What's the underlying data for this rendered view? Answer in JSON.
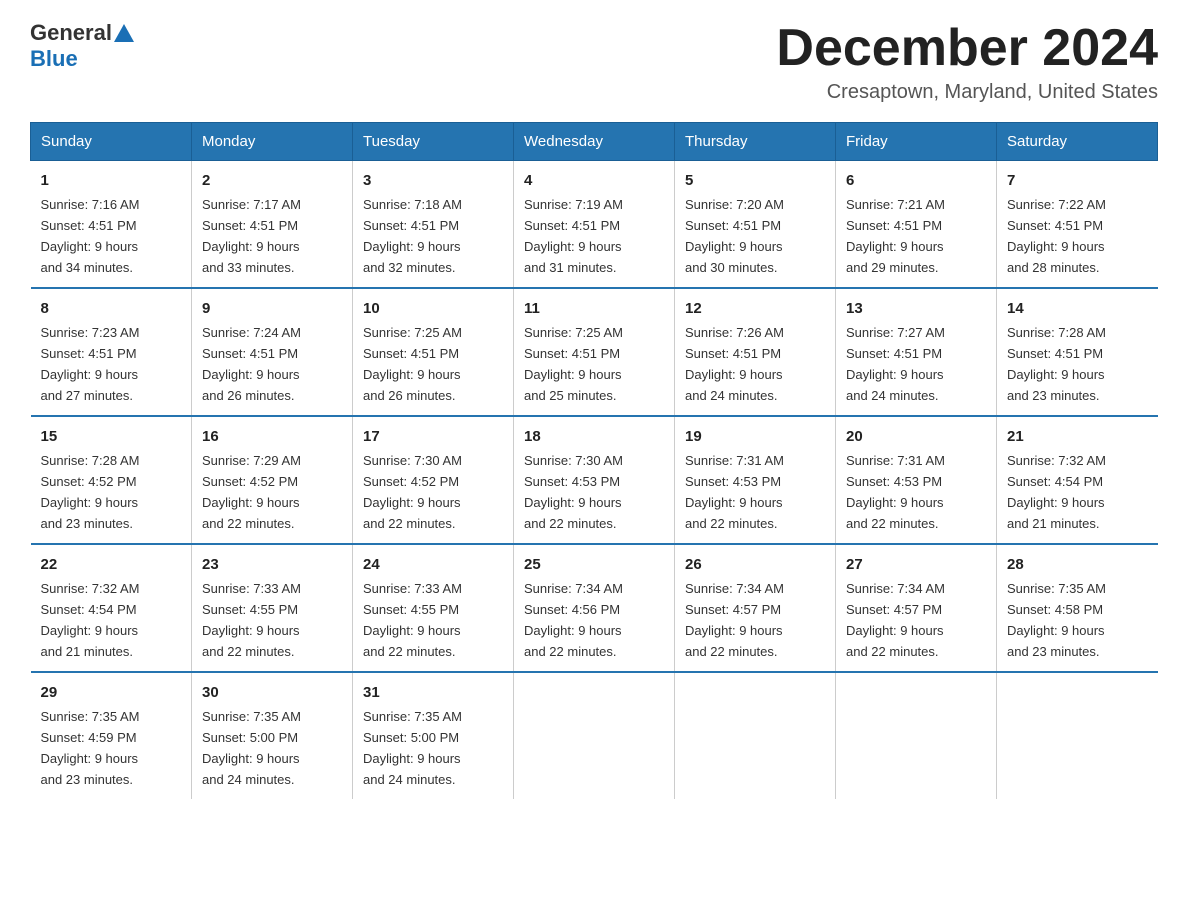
{
  "logo": {
    "general": "General",
    "blue": "Blue"
  },
  "title": "December 2024",
  "subtitle": "Cresaptown, Maryland, United States",
  "days_of_week": [
    "Sunday",
    "Monday",
    "Tuesday",
    "Wednesday",
    "Thursday",
    "Friday",
    "Saturday"
  ],
  "weeks": [
    [
      {
        "num": "1",
        "sunrise": "7:16 AM",
        "sunset": "4:51 PM",
        "daylight": "9 hours and 34 minutes."
      },
      {
        "num": "2",
        "sunrise": "7:17 AM",
        "sunset": "4:51 PM",
        "daylight": "9 hours and 33 minutes."
      },
      {
        "num": "3",
        "sunrise": "7:18 AM",
        "sunset": "4:51 PM",
        "daylight": "9 hours and 32 minutes."
      },
      {
        "num": "4",
        "sunrise": "7:19 AM",
        "sunset": "4:51 PM",
        "daylight": "9 hours and 31 minutes."
      },
      {
        "num": "5",
        "sunrise": "7:20 AM",
        "sunset": "4:51 PM",
        "daylight": "9 hours and 30 minutes."
      },
      {
        "num": "6",
        "sunrise": "7:21 AM",
        "sunset": "4:51 PM",
        "daylight": "9 hours and 29 minutes."
      },
      {
        "num": "7",
        "sunrise": "7:22 AM",
        "sunset": "4:51 PM",
        "daylight": "9 hours and 28 minutes."
      }
    ],
    [
      {
        "num": "8",
        "sunrise": "7:23 AM",
        "sunset": "4:51 PM",
        "daylight": "9 hours and 27 minutes."
      },
      {
        "num": "9",
        "sunrise": "7:24 AM",
        "sunset": "4:51 PM",
        "daylight": "9 hours and 26 minutes."
      },
      {
        "num": "10",
        "sunrise": "7:25 AM",
        "sunset": "4:51 PM",
        "daylight": "9 hours and 26 minutes."
      },
      {
        "num": "11",
        "sunrise": "7:25 AM",
        "sunset": "4:51 PM",
        "daylight": "9 hours and 25 minutes."
      },
      {
        "num": "12",
        "sunrise": "7:26 AM",
        "sunset": "4:51 PM",
        "daylight": "9 hours and 24 minutes."
      },
      {
        "num": "13",
        "sunrise": "7:27 AM",
        "sunset": "4:51 PM",
        "daylight": "9 hours and 24 minutes."
      },
      {
        "num": "14",
        "sunrise": "7:28 AM",
        "sunset": "4:51 PM",
        "daylight": "9 hours and 23 minutes."
      }
    ],
    [
      {
        "num": "15",
        "sunrise": "7:28 AM",
        "sunset": "4:52 PM",
        "daylight": "9 hours and 23 minutes."
      },
      {
        "num": "16",
        "sunrise": "7:29 AM",
        "sunset": "4:52 PM",
        "daylight": "9 hours and 22 minutes."
      },
      {
        "num": "17",
        "sunrise": "7:30 AM",
        "sunset": "4:52 PM",
        "daylight": "9 hours and 22 minutes."
      },
      {
        "num": "18",
        "sunrise": "7:30 AM",
        "sunset": "4:53 PM",
        "daylight": "9 hours and 22 minutes."
      },
      {
        "num": "19",
        "sunrise": "7:31 AM",
        "sunset": "4:53 PM",
        "daylight": "9 hours and 22 minutes."
      },
      {
        "num": "20",
        "sunrise": "7:31 AM",
        "sunset": "4:53 PM",
        "daylight": "9 hours and 22 minutes."
      },
      {
        "num": "21",
        "sunrise": "7:32 AM",
        "sunset": "4:54 PM",
        "daylight": "9 hours and 21 minutes."
      }
    ],
    [
      {
        "num": "22",
        "sunrise": "7:32 AM",
        "sunset": "4:54 PM",
        "daylight": "9 hours and 21 minutes."
      },
      {
        "num": "23",
        "sunrise": "7:33 AM",
        "sunset": "4:55 PM",
        "daylight": "9 hours and 22 minutes."
      },
      {
        "num": "24",
        "sunrise": "7:33 AM",
        "sunset": "4:55 PM",
        "daylight": "9 hours and 22 minutes."
      },
      {
        "num": "25",
        "sunrise": "7:34 AM",
        "sunset": "4:56 PM",
        "daylight": "9 hours and 22 minutes."
      },
      {
        "num": "26",
        "sunrise": "7:34 AM",
        "sunset": "4:57 PM",
        "daylight": "9 hours and 22 minutes."
      },
      {
        "num": "27",
        "sunrise": "7:34 AM",
        "sunset": "4:57 PM",
        "daylight": "9 hours and 22 minutes."
      },
      {
        "num": "28",
        "sunrise": "7:35 AM",
        "sunset": "4:58 PM",
        "daylight": "9 hours and 23 minutes."
      }
    ],
    [
      {
        "num": "29",
        "sunrise": "7:35 AM",
        "sunset": "4:59 PM",
        "daylight": "9 hours and 23 minutes."
      },
      {
        "num": "30",
        "sunrise": "7:35 AM",
        "sunset": "5:00 PM",
        "daylight": "9 hours and 24 minutes."
      },
      {
        "num": "31",
        "sunrise": "7:35 AM",
        "sunset": "5:00 PM",
        "daylight": "9 hours and 24 minutes."
      },
      null,
      null,
      null,
      null
    ]
  ],
  "labels": {
    "sunrise": "Sunrise:",
    "sunset": "Sunset:",
    "daylight": "Daylight:"
  }
}
